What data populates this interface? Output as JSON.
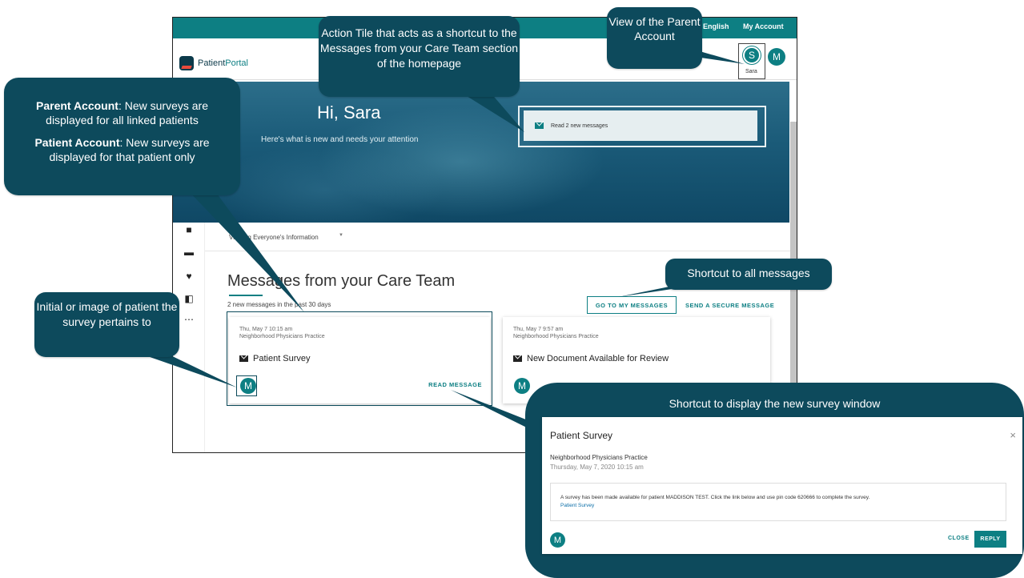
{
  "portal": {
    "logo_text": "Patient",
    "logo_text_accent": "Portal",
    "topbar": {
      "language": "⊕ English",
      "my_account": "My Account"
    },
    "profile": {
      "initial": "S",
      "name": "Sara",
      "other_initial": "M"
    }
  },
  "hero": {
    "greeting": "Hi, Sara",
    "subtitle": "Here's what is new and needs your attention",
    "action_tile_label": "Read 2 new messages"
  },
  "filter": {
    "label": "Viewing Everyone's Information",
    "caret": "▼"
  },
  "messages": {
    "title": "Messages from your Care Team",
    "subtitle": "2 new messages in the past 30 days",
    "go_to_button": "GO TO MY MESSAGES",
    "send_button": "SEND A SECURE MESSAGE",
    "cards": [
      {
        "date": "Thu, May 7 10:15 am",
        "org": "Neighborhood Physicians Practice",
        "subject": "Patient Survey",
        "initial": "M",
        "read_label": "READ MESSAGE"
      },
      {
        "date": "Thu, May 7 9:57 am",
        "org": "Neighborhood Physicians Practice",
        "subject": "New Document Available for Review",
        "initial": "M"
      }
    ]
  },
  "callouts": {
    "action_tile": "Action Tile that acts as a shortcut to the Messages from your Care Team section of the homepage",
    "parent_view": "View of the Parent Account",
    "parent_account_label": "Parent Account",
    "parent_account_text": ": New surveys are displayed for all linked patients",
    "patient_account_label": "Patient Account",
    "patient_account_text": ": New surveys are displayed for that patient only",
    "initial_image": "Initial or image of patient the survey pertains to",
    "shortcut_all": "Shortcut to all messages",
    "shortcut_survey": "Shortcut to display the new survey window"
  },
  "modal": {
    "title": "Patient Survey",
    "close_x": "×",
    "org": "Neighborhood Physicians Practice",
    "date": "Thursday, May 7, 2020 10:15 am",
    "body": "A survey has been made available for patient MADDISON TEST.  Click the link below and use pin code 620666 to complete the survey.",
    "link": "Patient Survey",
    "initial": "M",
    "close_button": "CLOSE",
    "reply_button": "REPLY"
  },
  "colors": {
    "teal": "#0d7f83",
    "callout_bg": "#0d4a5c"
  }
}
